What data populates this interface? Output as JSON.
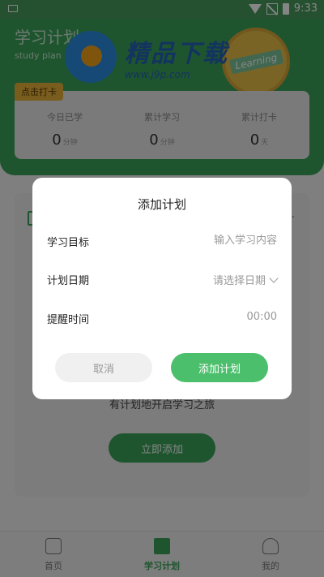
{
  "status_bar": {
    "time": "9:33"
  },
  "header": {
    "title": "学习计划",
    "subtitle": "study plan",
    "badge_text": "Learning",
    "checkin_label": "点击打卡",
    "stats": [
      {
        "label": "今日已学",
        "value": "0",
        "unit": "分钟"
      },
      {
        "label": "累计学习",
        "value": "0",
        "unit": "分钟"
      },
      {
        "label": "累计打卡",
        "value": "0",
        "unit": "天"
      }
    ]
  },
  "watermark": {
    "name": "精品下载",
    "url": "www.j9p.com"
  },
  "content": {
    "empty_text": "有计划地开启学习之旅",
    "add_now_label": "立即添加"
  },
  "dialog": {
    "title": "添加计划",
    "goal_label": "学习目标",
    "goal_placeholder": "输入学习内容",
    "date_label": "计划日期",
    "date_value": "请选择日期",
    "reminder_label": "提醒时间",
    "reminder_value": "00:00",
    "cancel_label": "取消",
    "confirm_label": "添加计划"
  },
  "bottom_nav": {
    "items": [
      {
        "label": "首页",
        "icon": "home-icon"
      },
      {
        "label": "学习计划",
        "icon": "graduation-cap-icon"
      },
      {
        "label": "我的",
        "icon": "user-icon"
      }
    ]
  },
  "colors": {
    "brand_green": "#3aa45b",
    "button_green": "#4cbf6c",
    "checkin_yellow": "#e9b33a"
  }
}
